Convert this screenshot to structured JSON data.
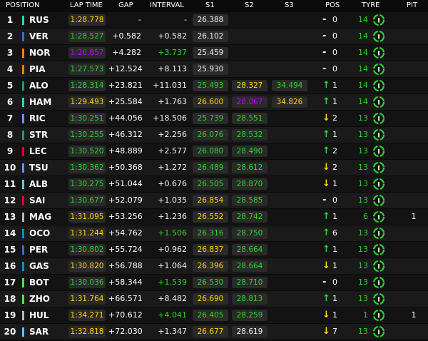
{
  "headers": {
    "position": "POSITION",
    "lap_time": "LAP TIME",
    "gap": "GAP",
    "interval": "INTERVAL",
    "s1": "S1",
    "s2": "S2",
    "s3": "S3",
    "pos": "POS",
    "tyre": "TYRE",
    "pit": "PIT"
  },
  "colors": {
    "yellow": "#ffd500",
    "purple": "#c400ff",
    "green": "#2bd42b",
    "white": "#f0f0f0",
    "up": "#2bd42b",
    "down": "#ffd500",
    "same": "#ffffff",
    "tyre_ring": "#2bd42b"
  },
  "rows": [
    {
      "pos": "1",
      "driver": "RUS",
      "team_color": "#26d7c3",
      "lap": "1:28.778",
      "lap_color": "yellow",
      "gap": "-",
      "interval": "-",
      "interval_color": "white",
      "s1": "26.388",
      "s1_color": "white",
      "s2": "",
      "s2_color": "",
      "s3": "",
      "s3_color": "",
      "dir": "-",
      "change": "0",
      "tyre_age": "14",
      "tyre": "I",
      "pit": ""
    },
    {
      "pos": "2",
      "driver": "VER",
      "team_color": "#3671c6",
      "lap": "1:28.527",
      "lap_color": "green",
      "gap": "+0.582",
      "interval": "+0.582",
      "interval_color": "white",
      "s1": "26.102",
      "s1_color": "white",
      "s2": "",
      "s2_color": "",
      "s3": "",
      "s3_color": "",
      "dir": "-",
      "change": "0",
      "tyre_age": "14",
      "tyre": "I",
      "pit": ""
    },
    {
      "pos": "3",
      "driver": "NOR",
      "team_color": "#ff8000",
      "lap": "1:26.857",
      "lap_color": "purple",
      "gap": "+4.282",
      "interval": "+3.737",
      "interval_color": "green",
      "s1": "25.459",
      "s1_color": "white",
      "s2": "",
      "s2_color": "",
      "s3": "",
      "s3_color": "",
      "dir": "-",
      "change": "0",
      "tyre_age": "14",
      "tyre": "I",
      "pit": ""
    },
    {
      "pos": "4",
      "driver": "PIA",
      "team_color": "#ff8000",
      "lap": "1:27.573",
      "lap_color": "green",
      "gap": "+12.524",
      "interval": "+8.113",
      "interval_color": "white",
      "s1": "25.930",
      "s1_color": "white",
      "s2": "",
      "s2_color": "",
      "s3": "",
      "s3_color": "",
      "dir": "-",
      "change": "0",
      "tyre_age": "14",
      "tyre": "I",
      "pit": ""
    },
    {
      "pos": "5",
      "driver": "ALO",
      "team_color": "#229971",
      "lap": "1:28.314",
      "lap_color": "green",
      "gap": "+23.821",
      "interval": "+11.031",
      "interval_color": "white",
      "s1": "25.493",
      "s1_color": "green",
      "s2": "28.327",
      "s2_color": "yellow",
      "s3": "34.494",
      "s3_color": "green",
      "dir": "up",
      "change": "1",
      "tyre_age": "14",
      "tyre": "I",
      "pit": ""
    },
    {
      "pos": "6",
      "driver": "HAM",
      "team_color": "#26d7c3",
      "lap": "1:29.493",
      "lap_color": "yellow",
      "gap": "+25.584",
      "interval": "+1.763",
      "interval_color": "white",
      "s1": "26.600",
      "s1_color": "yellow",
      "s2": "28.067",
      "s2_color": "purple",
      "s3": "34.826",
      "s3_color": "yellow",
      "dir": "up",
      "change": "1",
      "tyre_age": "14",
      "tyre": "I",
      "pit": ""
    },
    {
      "pos": "7",
      "driver": "RIC",
      "team_color": "#6692ff",
      "lap": "1:30.251",
      "lap_color": "green",
      "gap": "+44.056",
      "interval": "+18.506",
      "interval_color": "white",
      "s1": "25.739",
      "s1_color": "green",
      "s2": "28.551",
      "s2_color": "green",
      "s3": "",
      "s3_color": "",
      "dir": "down",
      "change": "2",
      "tyre_age": "13",
      "tyre": "I",
      "pit": ""
    },
    {
      "pos": "8",
      "driver": "STR",
      "team_color": "#229971",
      "lap": "1:30.255",
      "lap_color": "green",
      "gap": "+46.312",
      "interval": "+2.256",
      "interval_color": "white",
      "s1": "26.076",
      "s1_color": "green",
      "s2": "28.532",
      "s2_color": "green",
      "s3": "",
      "s3_color": "",
      "dir": "up",
      "change": "1",
      "tyre_age": "13",
      "tyre": "I",
      "pit": ""
    },
    {
      "pos": "9",
      "driver": "LEC",
      "team_color": "#e8002d",
      "lap": "1:30.520",
      "lap_color": "green",
      "gap": "+48.889",
      "interval": "+2.577",
      "interval_color": "white",
      "s1": "26.080",
      "s1_color": "green",
      "s2": "28.490",
      "s2_color": "green",
      "s3": "",
      "s3_color": "",
      "dir": "up",
      "change": "2",
      "tyre_age": "13",
      "tyre": "I",
      "pit": ""
    },
    {
      "pos": "10",
      "driver": "TSU",
      "team_color": "#6692ff",
      "lap": "1:30.362",
      "lap_color": "green",
      "gap": "+50.368",
      "interval": "+1.272",
      "interval_color": "white",
      "s1": "26.489",
      "s1_color": "green",
      "s2": "28.612",
      "s2_color": "green",
      "s3": "",
      "s3_color": "",
      "dir": "down",
      "change": "2",
      "tyre_age": "13",
      "tyre": "I",
      "pit": ""
    },
    {
      "pos": "11",
      "driver": "ALB",
      "team_color": "#64c4ff",
      "lap": "1:30.275",
      "lap_color": "green",
      "gap": "+51.044",
      "interval": "+0.676",
      "interval_color": "white",
      "s1": "26.505",
      "s1_color": "green",
      "s2": "28.870",
      "s2_color": "green",
      "s3": "",
      "s3_color": "",
      "dir": "down",
      "change": "1",
      "tyre_age": "13",
      "tyre": "I",
      "pit": ""
    },
    {
      "pos": "12",
      "driver": "SAI",
      "team_color": "#e8002d",
      "lap": "1:30.677",
      "lap_color": "green",
      "gap": "+52.079",
      "interval": "+1.035",
      "interval_color": "white",
      "s1": "26.854",
      "s1_color": "yellow",
      "s2": "28.585",
      "s2_color": "green",
      "s3": "",
      "s3_color": "",
      "dir": "-",
      "change": "0",
      "tyre_age": "13",
      "tyre": "I",
      "pit": ""
    },
    {
      "pos": "13",
      "driver": "MAG",
      "team_color": "#b6babd",
      "lap": "1:31.095",
      "lap_color": "yellow",
      "gap": "+53.256",
      "interval": "+1.236",
      "interval_color": "white",
      "s1": "26.552",
      "s1_color": "yellow",
      "s2": "28.742",
      "s2_color": "green",
      "s3": "",
      "s3_color": "",
      "dir": "up",
      "change": "1",
      "tyre_age": "6",
      "tyre": "I",
      "pit": "1"
    },
    {
      "pos": "14",
      "driver": "OCO",
      "team_color": "#0093cc",
      "lap": "1:31.244",
      "lap_color": "yellow",
      "gap": "+54.762",
      "interval": "+1.506",
      "interval_color": "green",
      "s1": "26.316",
      "s1_color": "green",
      "s2": "28.750",
      "s2_color": "green",
      "s3": "",
      "s3_color": "",
      "dir": "up",
      "change": "6",
      "tyre_age": "13",
      "tyre": "I",
      "pit": ""
    },
    {
      "pos": "15",
      "driver": "PER",
      "team_color": "#3671c6",
      "lap": "1:30.802",
      "lap_color": "green",
      "gap": "+55.724",
      "interval": "+0.962",
      "interval_color": "white",
      "s1": "26.837",
      "s1_color": "yellow",
      "s2": "28.664",
      "s2_color": "green",
      "s3": "",
      "s3_color": "",
      "dir": "up",
      "change": "1",
      "tyre_age": "13",
      "tyre": "I",
      "pit": ""
    },
    {
      "pos": "16",
      "driver": "GAS",
      "team_color": "#0093cc",
      "lap": "1:30.820",
      "lap_color": "yellow",
      "gap": "+56.788",
      "interval": "+1.064",
      "interval_color": "white",
      "s1": "26.396",
      "s1_color": "yellow",
      "s2": "28.664",
      "s2_color": "green",
      "s3": "",
      "s3_color": "",
      "dir": "down",
      "change": "1",
      "tyre_age": "13",
      "tyre": "I",
      "pit": ""
    },
    {
      "pos": "17",
      "driver": "BOT",
      "team_color": "#52e252",
      "lap": "1:30.036",
      "lap_color": "green",
      "gap": "+58.344",
      "interval": "+1.539",
      "interval_color": "green",
      "s1": "26.530",
      "s1_color": "green",
      "s2": "28.710",
      "s2_color": "green",
      "s3": "",
      "s3_color": "",
      "dir": "-",
      "change": "0",
      "tyre_age": "13",
      "tyre": "I",
      "pit": ""
    },
    {
      "pos": "18",
      "driver": "ZHO",
      "team_color": "#52e252",
      "lap": "1:31.764",
      "lap_color": "yellow",
      "gap": "+66.571",
      "interval": "+8.482",
      "interval_color": "white",
      "s1": "26.690",
      "s1_color": "yellow",
      "s2": "28.813",
      "s2_color": "green",
      "s3": "",
      "s3_color": "",
      "dir": "up",
      "change": "1",
      "tyre_age": "13",
      "tyre": "I",
      "pit": ""
    },
    {
      "pos": "19",
      "driver": "HUL",
      "team_color": "#b6babd",
      "lap": "1:34.271",
      "lap_color": "yellow",
      "gap": "+70.612",
      "interval": "+4.041",
      "interval_color": "green",
      "s1": "26.405",
      "s1_color": "green",
      "s2": "28.259",
      "s2_color": "green",
      "s3": "",
      "s3_color": "",
      "dir": "down",
      "change": "1",
      "tyre_age": "1",
      "tyre": "I",
      "pit": "1"
    },
    {
      "pos": "20",
      "driver": "SAR",
      "team_color": "#64c4ff",
      "lap": "1:32.818",
      "lap_color": "yellow",
      "gap": "+72.030",
      "interval": "+1.347",
      "interval_color": "white",
      "s1": "26.677",
      "s1_color": "yellow",
      "s2": "28.619",
      "s2_color": "white",
      "s3": "",
      "s3_color": "",
      "dir": "down",
      "change": "7",
      "tyre_age": "13",
      "tyre": "I",
      "pit": ""
    }
  ]
}
